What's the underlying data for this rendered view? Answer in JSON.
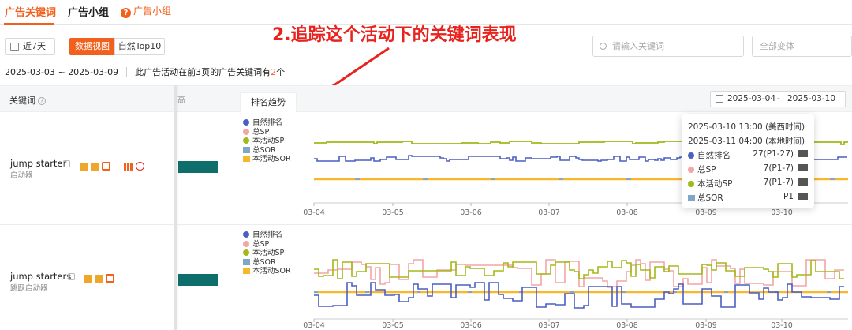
{
  "tabs": [
    {
      "label": "广告关键词"
    },
    {
      "label": "广告小组"
    },
    {
      "label": "广告小组"
    }
  ],
  "toolbar": {
    "date_label": "近7天",
    "view_data": "数据视图",
    "view_top": "自然Top10",
    "search_placeholder": "请输入关键词",
    "variant_placeholder": "全部变体"
  },
  "annotation": "2.追踪这个活动下的关键词表现",
  "summary": {
    "range": "2025-03-03 ~ 2025-03-09",
    "text_before": "此广告活动在前3页的广告关键词有",
    "count": "2",
    "text_after": "个"
  },
  "table": {
    "col_keyword": "关键词",
    "col_cut": "高",
    "trend_tab": "排名趋势",
    "date_from": "2025-03-04",
    "date_sep": "-",
    "date_to": "2025-03-10"
  },
  "rows": [
    {
      "keyword": "jump starter",
      "translation": "启动器"
    },
    {
      "keyword": "jump starters",
      "translation": "跳跃启动器"
    }
  ],
  "legend": [
    {
      "label": "自然排名",
      "color": "#4a5fc1",
      "shape": "dot"
    },
    {
      "label": "总SP",
      "color": "#f4a5a5",
      "shape": "dot"
    },
    {
      "label": "本活动SP",
      "color": "#a3b81a",
      "shape": "dot"
    },
    {
      "label": "总SOR",
      "color": "#7fa7c8",
      "shape": "square"
    },
    {
      "label": "本活动SOR",
      "color": "#f9b82b",
      "shape": "square"
    }
  ],
  "x_ticks": [
    "03-04",
    "03-05",
    "03-06",
    "03-07",
    "03-08",
    "03-09",
    "03-10"
  ],
  "tooltip": {
    "time_us": "2025-03-10 13:00 (美西时间)",
    "time_local": "2025-03-11 04:00 (本地时间)",
    "rows": [
      {
        "label": "自然排名",
        "value": "27(P1-27)",
        "color": "#4a5fc1"
      },
      {
        "label": "总SP",
        "value": "7(P1-7)",
        "color": "#f4a5a5"
      },
      {
        "label": "本活动SP",
        "value": "7(P1-7)",
        "color": "#a3b81a"
      },
      {
        "label": "总SOR",
        "value": "P1",
        "color": "#7fa7c8"
      }
    ]
  },
  "colors": {
    "accent": "#f2601d",
    "annotation": "#e8221d",
    "teal": "#0e6e6c"
  }
}
